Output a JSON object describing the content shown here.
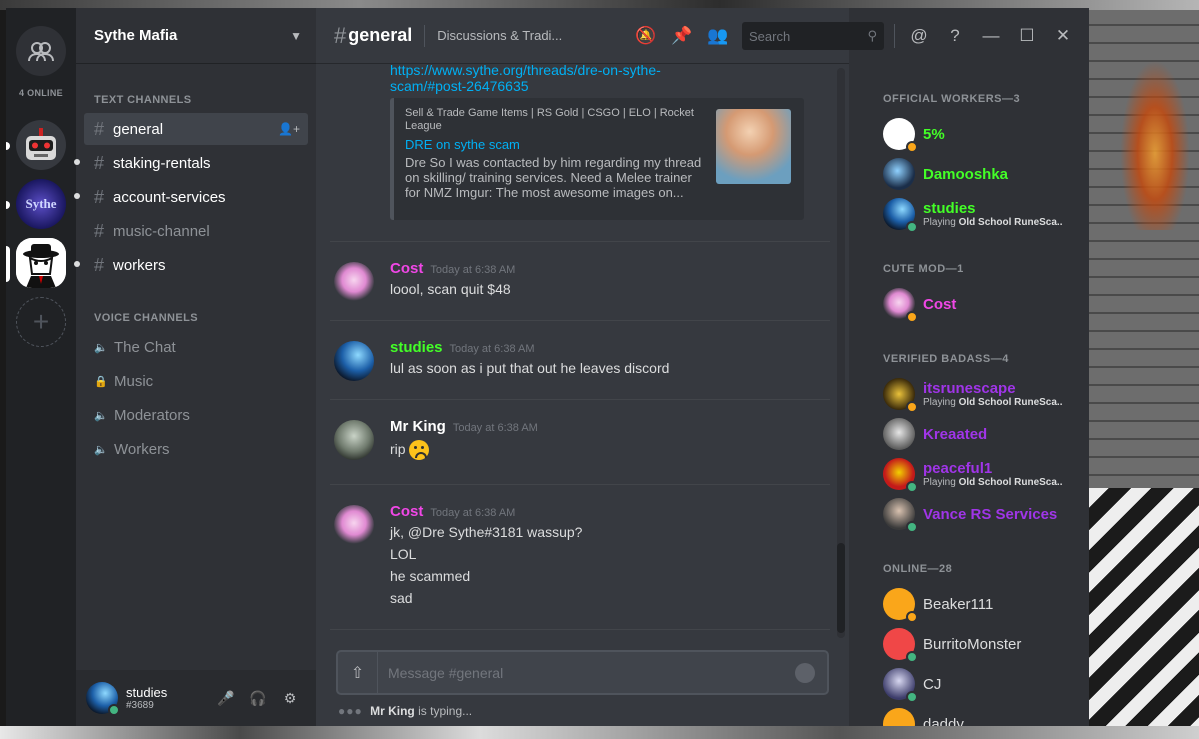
{
  "colors": {
    "worker_green": "#43ff27",
    "mod_pink": "#f047e6",
    "badass_purple": "#a035e8",
    "link_blue": "#00b0f4",
    "online": "#43b581",
    "idle": "#faa61a",
    "dnd": "#f04747",
    "discord_blurple": "#7289da"
  },
  "guilds": {
    "online_count": "4 ONLINE",
    "g2_text": "Sythe",
    "add_glyph": "+"
  },
  "server": {
    "name": "Sythe Mafia",
    "text_category": "TEXT CHANNELS",
    "voice_category": "VOICE CHANNELS",
    "text_channels": [
      {
        "name": "general"
      },
      {
        "name": "staking-rentals"
      },
      {
        "name": "account-services"
      },
      {
        "name": "music-channel"
      },
      {
        "name": "workers"
      }
    ],
    "voice_channels": [
      {
        "name": "The Chat",
        "icon": "speaker-icon"
      },
      {
        "name": "Music",
        "icon": "lock-icon"
      },
      {
        "name": "Moderators",
        "icon": "speaker-icon"
      },
      {
        "name": "Workers",
        "icon": "speaker-icon"
      }
    ]
  },
  "user": {
    "name": "studies",
    "discriminator": "#3689"
  },
  "channel": {
    "name": "general",
    "topic": "Discussions & Tradi..."
  },
  "search": {
    "placeholder": "Search"
  },
  "embed": {
    "url": "https://www.sythe.org/threads/dre-on-sythe-scam/#post-26476635",
    "provider": "Sell & Trade Game Items | RS Gold | CSGO | ELO | Rocket League",
    "title": "DRE on sythe scam",
    "description": "Dre So I was contacted by him regarding my thread on skilling/ training services. Need a Melee trainer for NMZ Imgur: The most awesome images on..."
  },
  "messages": [
    {
      "author": "Cost",
      "time": "Today at 6:38 AM",
      "lines": [
        "loool, scan quit $48"
      ]
    },
    {
      "author": "studies",
      "time": "Today at 6:38 AM",
      "lines": [
        "lul as soon as i put that out he leaves discord"
      ]
    },
    {
      "author": "Mr King",
      "time": "Today at 6:38 AM",
      "lines": [
        "rip"
      ]
    },
    {
      "author": "Cost",
      "time": "Today at 6:38 AM",
      "lines": [
        "jk, @Dre Sythe#3181  wassup?",
        "LOL",
        "he scammed",
        "sad"
      ]
    }
  ],
  "composer": {
    "placeholder": "Message #general"
  },
  "typing": {
    "user": "Mr King",
    "text": "is typing..."
  },
  "members": {
    "categories": [
      "OFFICIAL WORKERS—3",
      "CUTE MOD—1",
      "VERIFIED BADASS—4",
      "ONLINE—28"
    ],
    "list": [
      {
        "name": "5%",
        "game": ""
      },
      {
        "name": "Damooshka",
        "game": ""
      },
      {
        "name": "studies",
        "game_prefix": "Playing ",
        "game": "Old School RuneSca..."
      },
      {
        "name": "Cost",
        "game": ""
      },
      {
        "name": "itsrunescape",
        "game_prefix": "Playing ",
        "game": "Old School RuneSca..."
      },
      {
        "name": "Kreaated",
        "game": ""
      },
      {
        "name": "peaceful1",
        "game_prefix": "Playing ",
        "game": "Old School RuneSca..."
      },
      {
        "name": "Vance RS Services",
        "game": ""
      },
      {
        "name": "Beaker111",
        "game": ""
      },
      {
        "name": "BurritoMonster",
        "game": ""
      },
      {
        "name": "CJ",
        "game": ""
      },
      {
        "name": "daddy",
        "game": ""
      }
    ]
  }
}
